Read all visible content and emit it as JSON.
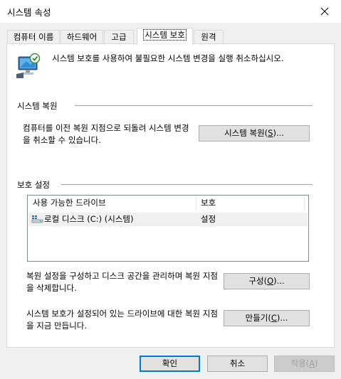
{
  "window": {
    "title": "시스템 속성"
  },
  "tabs": [
    {
      "label": "컴퓨터 이름"
    },
    {
      "label": "하드웨어"
    },
    {
      "label": "고급"
    },
    {
      "label": "시스템 보호"
    },
    {
      "label": "원격"
    }
  ],
  "intro": {
    "text": "시스템 보호를 사용하여 불필요한 시스템 변경을 실행 취소하십시오."
  },
  "restore": {
    "section_title": "시스템 복원",
    "description": "컴퓨터를 이전 복원 지점으로 되돌려 시스템 변경을 취소할 수 있습니다.",
    "button_pre": "시스템 복원(",
    "button_key": "S",
    "button_post": ")..."
  },
  "protection": {
    "section_title": "보호 설정",
    "columns": [
      "사용 가능한 드라이브",
      "보호"
    ],
    "rows": [
      {
        "drive": "로컬 디스크 (C:) (시스템)",
        "status": "설정"
      }
    ],
    "configure_description": "복원 설정을 구성하고 디스크 공간을 관리하며 복원 지점을 삭제합니다.",
    "configure_pre": "구성(",
    "configure_key": "O",
    "configure_post": ")...",
    "create_description": "시스템 보호가 설정되어 있는 드라이브에 대한 복원 지점을 지금 만듭니다.",
    "create_pre": "만들기(",
    "create_key": "C",
    "create_post": ")..."
  },
  "footer": {
    "ok_label": "확인",
    "cancel_label": "취소",
    "apply_pre": "적용(",
    "apply_key": "A",
    "apply_post": ")"
  },
  "icons": {
    "close": "close-icon",
    "system_protection": "computer-shield-icon",
    "drive": "drive-icon"
  },
  "colors": {
    "accent": "#0078d7",
    "panel": "#ffffff",
    "background": "#f0f0f0"
  }
}
